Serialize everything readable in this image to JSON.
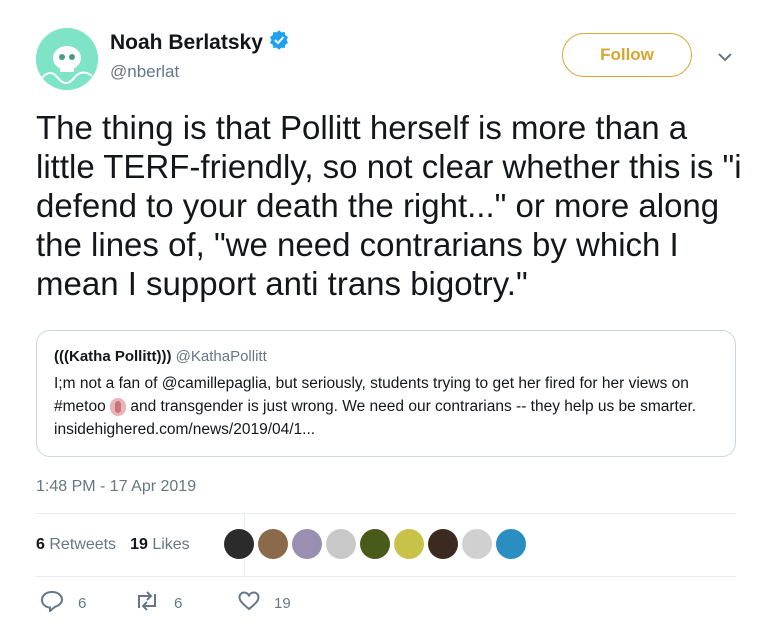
{
  "author": {
    "name": "Noah Berlatsky",
    "handle": "@nberlat",
    "follow_label": "Follow"
  },
  "tweet": {
    "text": "The thing is that Pollitt herself is more than a little TERF-friendly, so not clear whether this is \"i defend to your death the right...\" or more along the lines of, \"we need contrarians by which I mean I support anti trans bigotry.\"",
    "timestamp": "1:48 PM - 17 Apr 2019"
  },
  "quoted": {
    "name": "(((Katha Pollitt)))",
    "handle": "@KathaPollitt",
    "text_part1": "I;m not a fan of  @camillepaglia, but seriously, students trying to get her fired for her views on #metoo",
    "text_part2": " and transgender is just wrong.  We need our contrarians -- they help us be smarter. insidehighered.com/news/2019/04/1..."
  },
  "stats": {
    "retweets_count": "6",
    "retweets_label": "Retweets",
    "likes_count": "19",
    "likes_label": "Likes",
    "liker_avatars": [
      "#2b2b2b",
      "#8a6a4a",
      "#9a8fb0",
      "#c8c8c8",
      "#4a5a1a",
      "#c9c24a",
      "#3a2a20",
      "#d0d0d0",
      "#2a8fc0"
    ]
  },
  "actions": {
    "reply_count": "6",
    "retweet_count": "6",
    "like_count": "19"
  },
  "colors": {
    "follow_accent": "#d8a630",
    "verified": "#1da1f2",
    "secondary_text": "#657786"
  }
}
